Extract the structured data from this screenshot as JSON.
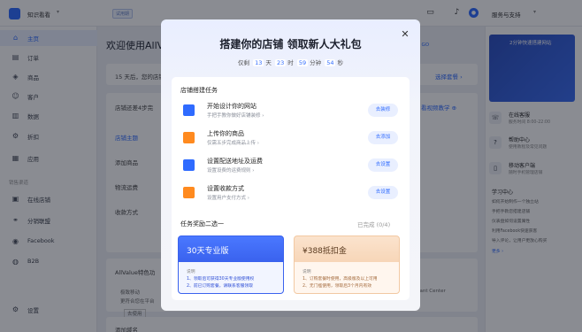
{
  "topbar": {
    "store_name": "知识看看",
    "trial_badge": "试用期",
    "service_label": "服务与支持"
  },
  "sidebar": {
    "items": [
      {
        "icon": "home-icon",
        "label": "主页",
        "active": true
      },
      {
        "icon": "order-icon",
        "label": "订单"
      },
      {
        "icon": "product-icon",
        "label": "商品"
      },
      {
        "icon": "customer-icon",
        "label": "客户"
      },
      {
        "icon": "data-icon",
        "label": "数据"
      },
      {
        "icon": "discount-icon",
        "label": "折扣"
      },
      {
        "icon": "app-icon",
        "label": "应用"
      }
    ],
    "channel_section": "销售渠道",
    "channels": [
      {
        "icon": "online-store-icon",
        "label": "在线店铺"
      },
      {
        "icon": "affiliate-icon",
        "label": "分销联盟"
      },
      {
        "icon": "facebook-icon",
        "label": "Facebook"
      },
      {
        "icon": "b2b-icon",
        "label": "B2B"
      }
    ],
    "settings": {
      "icon": "gear-icon",
      "label": "设置"
    }
  },
  "main": {
    "welcome": "欢迎使用AllV",
    "banner_text": "15 天后，您的店铺",
    "banner_link": "选择套餐 ›",
    "setup_title": "店铺还差4步完",
    "setup_items": [
      "店铺主题",
      "添加商品",
      "物流运费",
      "收款方式"
    ],
    "video_link": "看视频教学 ⊕",
    "features_title": "AllValue特色功",
    "feature_card_title": "极致移动",
    "feature_card_desc": "更符合您在平台",
    "feature_card_btn": "去使用",
    "merchant_center": "chant Center",
    "add_domain": "添加域名",
    "new_task_link": "新手任务·立即 GO"
  },
  "right": {
    "promo_text": "2分钟快速搭建网站",
    "help": [
      {
        "icon": "phone-icon",
        "title": "在线客服",
        "sub": "服务时间 8:00-22:00"
      },
      {
        "icon": "help-icon",
        "title": "帮助中心",
        "sub": "使用教程及常见问题"
      },
      {
        "icon": "mobile-icon",
        "title": "移动客户端",
        "sub": "随时手机管理店铺"
      }
    ],
    "learn_title": "学习中心",
    "learn_items": [
      "如何开始制作一个独立站",
      "手把手教您搭建店铺",
      "仪表盘如何设置属性",
      "利用Facebook快速获客",
      "导入评论，让用户更放心购买"
    ],
    "learn_more": "更多 ›"
  },
  "modal": {
    "title": "搭建你的店铺 领取新人大礼包",
    "countdown_prefix": "仅剩",
    "days": "13",
    "days_unit": "天",
    "hours": "23",
    "hours_unit": "时",
    "minutes": "59",
    "minutes_unit": "分钟",
    "seconds": "54",
    "seconds_unit": "秒",
    "tasks_title": "店铺搭建任务",
    "tasks": [
      {
        "icon": "paint-roller-icon",
        "name": "开始设计你的网站",
        "desc": "手把手教你做好店铺装修 ›",
        "btn": "去装修",
        "color": "#2f6bff"
      },
      {
        "icon": "shopping-bag-icon",
        "name": "上传你的商品",
        "desc": "仅需五步完成商品上传 ›",
        "btn": "去添加",
        "color": "#ff8a1f"
      },
      {
        "icon": "truck-icon",
        "name": "设置配送地址及运费",
        "desc": "设置设费的运费规则 ›",
        "btn": "去设置",
        "color": "#2f6bff"
      },
      {
        "icon": "card-icon",
        "name": "设置收款方式",
        "desc": "设置用户支付方式 ›",
        "btn": "去设置",
        "color": "#ff8a1f"
      }
    ],
    "reward_title": "任务奖励二选一",
    "reward_status": "已完成 (0/4)",
    "rewards": [
      {
        "head": "30天专业版",
        "sub": "说明",
        "lines": [
          "1、领取后可获得30天专业版使用权",
          "2、前已订购套餐，请联系客服领取"
        ]
      },
      {
        "head": "¥388抵扣金",
        "sub": "说明",
        "lines": [
          "1、订购套餐时使用，高级版及以上可用",
          "2、无门槛使用，领取后3个月内有效"
        ]
      }
    ]
  }
}
